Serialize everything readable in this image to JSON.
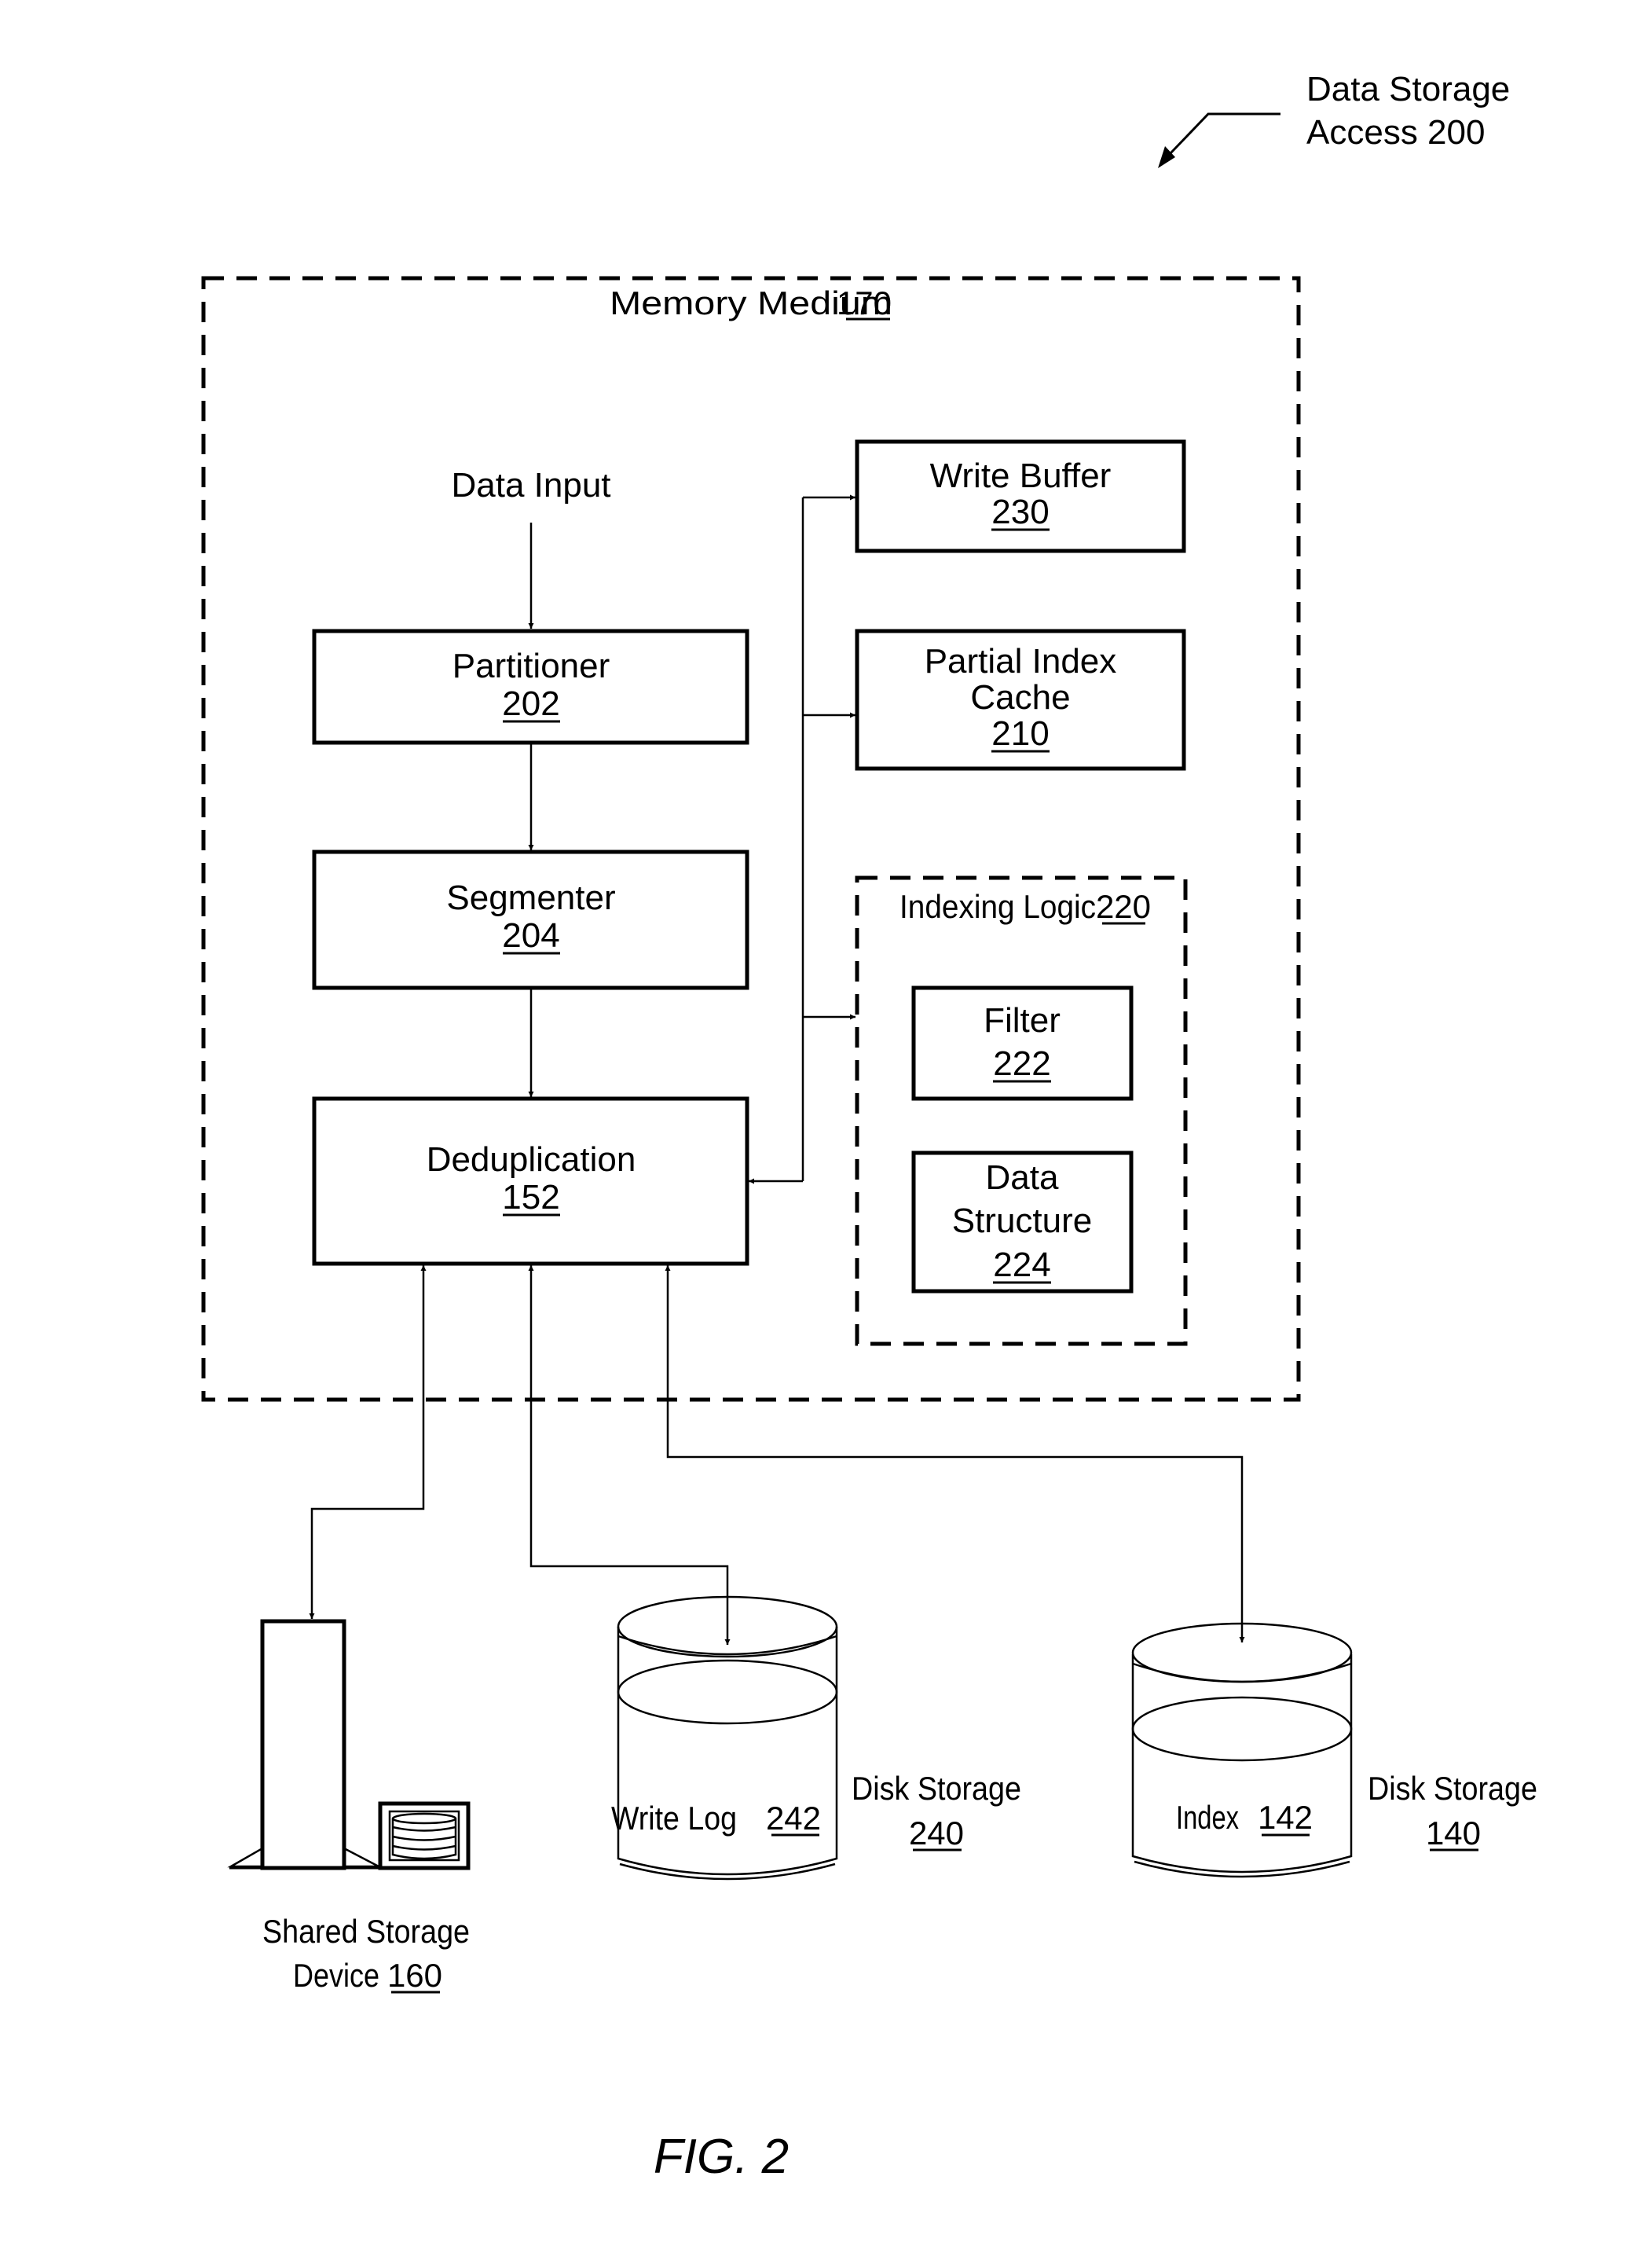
{
  "figure": {
    "label": "FIG. 2",
    "reference": {
      "line1": "Data Storage",
      "line2": "Access 200"
    }
  },
  "memory_medium": {
    "name": "Memory Medium",
    "number": "170"
  },
  "data_input": {
    "label": "Data Input"
  },
  "blocks": {
    "partitioner": {
      "name": "Partitioner",
      "number": "202"
    },
    "segmenter": {
      "name": "Segmenter",
      "number": "204"
    },
    "deduplication": {
      "name": "Deduplication",
      "number": "152"
    },
    "write_buffer": {
      "name": "Write Buffer",
      "number": "230"
    },
    "partial_index_cache": {
      "line1": "Partial Index",
      "line2": "Cache",
      "number": "210"
    },
    "indexing_logic": {
      "name": "Indexing Logic",
      "number": "220"
    },
    "filter": {
      "name": "Filter",
      "number": "222"
    },
    "data_structure": {
      "line1": "Data",
      "line2": "Structure",
      "number": "224"
    }
  },
  "storage": {
    "shared_storage": {
      "line1": "Shared Storage",
      "line2": "Device",
      "number": "160"
    },
    "disk_storage_240": {
      "name": "Disk Storage",
      "number": "240",
      "content_name": "Write Log",
      "content_number": "242"
    },
    "disk_storage_140": {
      "name": "Disk Storage",
      "number": "140",
      "content_name": "Index",
      "content_number": "142"
    }
  }
}
